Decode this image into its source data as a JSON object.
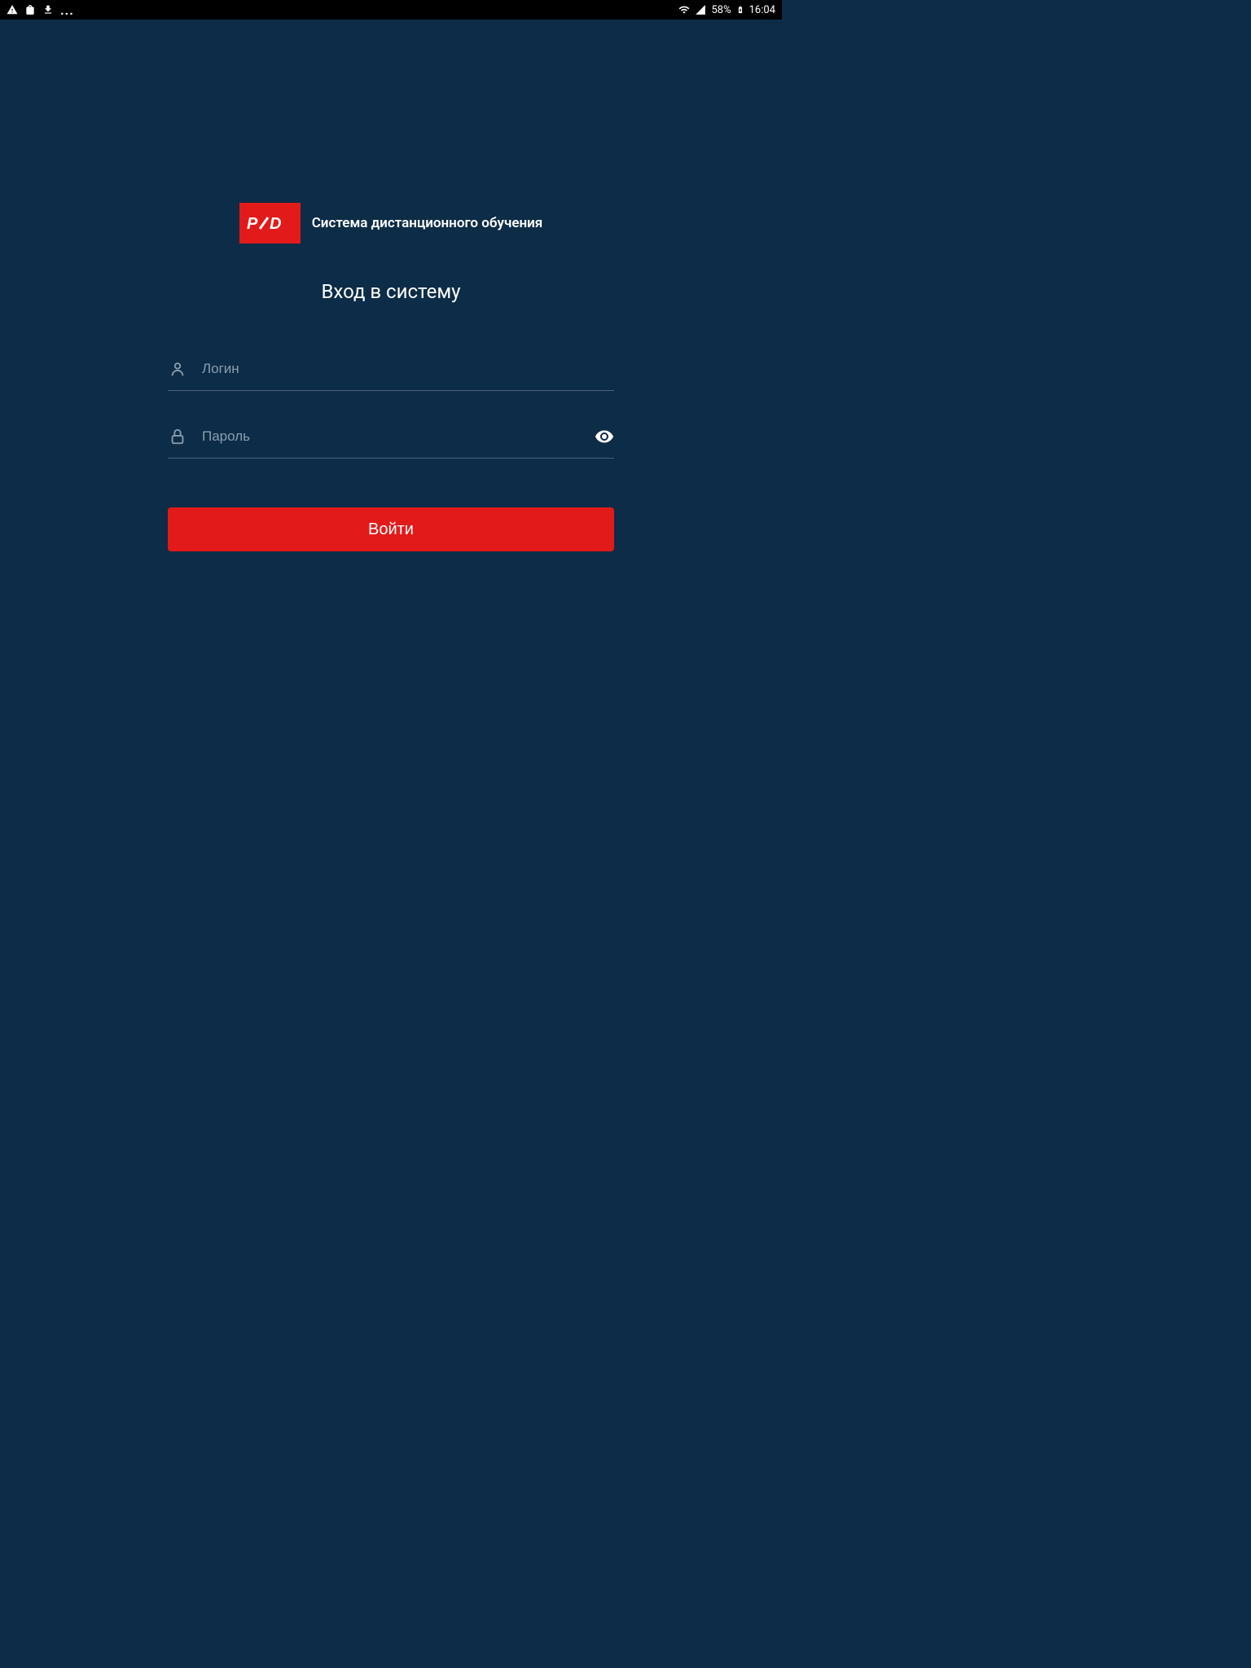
{
  "statusBar": {
    "batteryPercent": "58%",
    "time": "16:04",
    "moreIcon": "..."
  },
  "logo": {
    "text": "ржд",
    "title": "Система дистанционного обучения"
  },
  "pageTitle": "Вход в систему",
  "form": {
    "login": {
      "placeholder": "Логин",
      "value": ""
    },
    "password": {
      "placeholder": "Пароль",
      "value": ""
    },
    "submitLabel": "Войти"
  }
}
